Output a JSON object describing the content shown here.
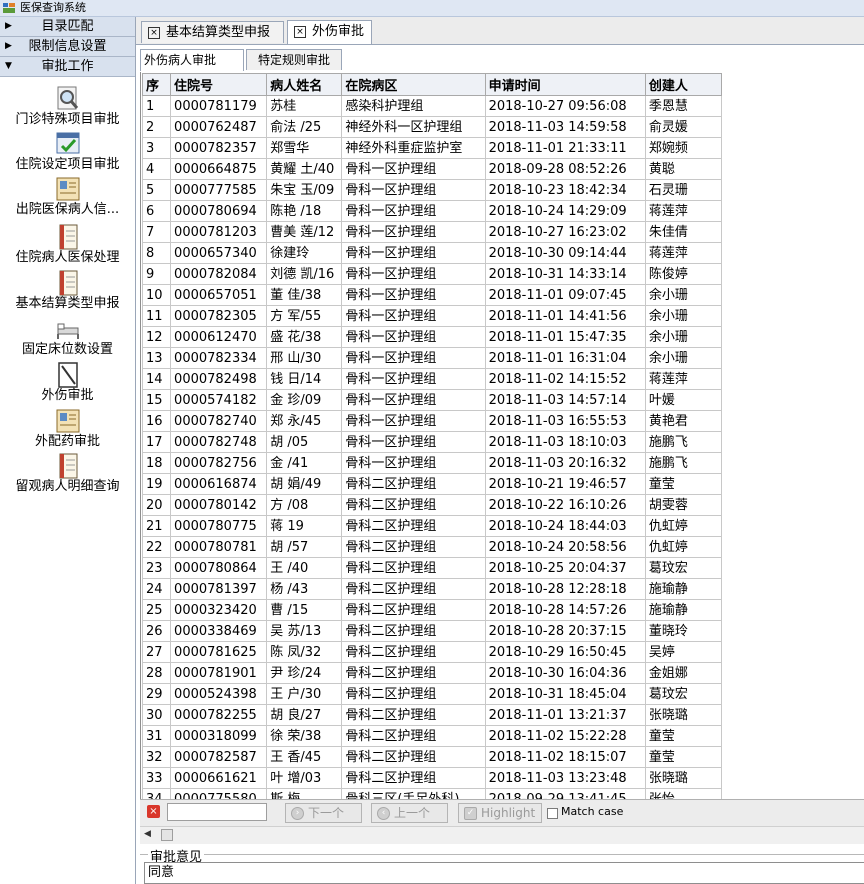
{
  "window": {
    "title": "医保查询系统"
  },
  "sidebar": {
    "headers": [
      {
        "label": "目录匹配",
        "arrow": "▶"
      },
      {
        "label": "限制信息设置",
        "arrow": "▶"
      },
      {
        "label": "审批工作",
        "arrow": "▼"
      }
    ],
    "items": [
      {
        "label": "门诊特殊项目审批",
        "icon": "magnifier-icon"
      },
      {
        "label": "住院设定项目审批",
        "icon": "checklist-icon"
      },
      {
        "label": "出院医保病人信...",
        "icon": "patient-card-icon"
      },
      {
        "label": "住院病人医保处理",
        "icon": "notebook-icon"
      },
      {
        "label": "基本结算类型申报",
        "icon": "notebook-icon"
      },
      {
        "label": "固定床位数设置",
        "icon": "bed-icon"
      },
      {
        "label": "外伤审批",
        "icon": "document-icon"
      },
      {
        "label": "外配药审批",
        "icon": "patient-card-icon"
      },
      {
        "label": "留观病人明细查询",
        "icon": "notebook-icon"
      }
    ]
  },
  "tabs": [
    {
      "label": "基本结算类型申报",
      "close": "×"
    },
    {
      "label": "外伤审批",
      "close": "×"
    }
  ],
  "subtabs": [
    {
      "label": "外伤病人审批"
    },
    {
      "label": "特定规则审批"
    }
  ],
  "grid": {
    "columns": [
      "序",
      "住院号",
      "病人姓名",
      "在院病区",
      "申请时间",
      "创建人"
    ],
    "rows": [
      [
        "1",
        "0000781179",
        "苏桂 ",
        "感染科护理组",
        "2018-10-27 09:56:08",
        "季恩慧"
      ],
      [
        "2",
        "0000762487",
        "俞法 /25",
        "神经外科一区护理组",
        "2018-11-03 14:59:58",
        "俞灵媛"
      ],
      [
        "3",
        "0000782357",
        "郑雪华",
        "神经外科重症监护室",
        "2018-11-01 21:33:11",
        "郑婉频"
      ],
      [
        "4",
        "0000664875",
        "黄耀 土/40",
        "骨科一区护理组",
        "2018-09-28 08:52:26",
        "黄聪"
      ],
      [
        "5",
        "0000777585",
        "朱宝 玉/09",
        "骨科一区护理组",
        "2018-10-23 18:42:34",
        "石灵珊"
      ],
      [
        "6",
        "0000780694",
        "陈艳 /18",
        "骨科一区护理组",
        "2018-10-24 14:29:09",
        "蒋莲萍"
      ],
      [
        "7",
        "0000781203",
        "曹美 莲/12",
        "骨科一区护理组",
        "2018-10-27 16:23:02",
        "朱佳倩"
      ],
      [
        "8",
        "0000657340",
        "徐建玲",
        "骨科一区护理组",
        "2018-10-30 09:14:44",
        "蒋莲萍"
      ],
      [
        "9",
        "0000782084",
        "刘德 凯/16",
        "骨科一区护理组",
        "2018-10-31 14:33:14",
        "陈俊婷"
      ],
      [
        "10",
        "0000657051",
        "董 佳/38",
        "骨科一区护理组",
        "2018-11-01 09:07:45",
        "余小珊"
      ],
      [
        "11",
        "0000782305",
        "方 军/55",
        "骨科一区护理组",
        "2018-11-01 14:41:56",
        "余小珊"
      ],
      [
        "12",
        "0000612470",
        "盛 花/38",
        "骨科一区护理组",
        "2018-11-01 15:47:35",
        "余小珊"
      ],
      [
        "13",
        "0000782334",
        "邢 山/30",
        "骨科一区护理组",
        "2018-11-01 16:31:04",
        "余小珊"
      ],
      [
        "14",
        "0000782498",
        "钱 日/14",
        "骨科一区护理组",
        "2018-11-02 14:15:52",
        "蒋莲萍"
      ],
      [
        "15",
        "0000574182",
        "金 珍/09",
        "骨科一区护理组",
        "2018-11-03 14:57:14",
        "叶媛"
      ],
      [
        "16",
        "0000782740",
        "郑 永/45",
        "骨科一区护理组",
        "2018-11-03 16:55:53",
        "黄艳君"
      ],
      [
        "17",
        "0000782748",
        "胡 /05",
        "骨科一区护理组",
        "2018-11-03 18:10:03",
        "施鹏飞"
      ],
      [
        "18",
        "0000782756",
        "金 /41",
        "骨科一区护理组",
        "2018-11-03 20:16:32",
        "施鹏飞"
      ],
      [
        "19",
        "0000616874",
        "胡 娟/49",
        "骨科二区护理组",
        "2018-10-21 19:46:57",
        "童莹"
      ],
      [
        "20",
        "0000780142",
        "方 /08",
        "骨科二区护理组",
        "2018-10-22 16:10:26",
        "胡雯蓉"
      ],
      [
        "21",
        "0000780775",
        "蒋 19",
        "骨科二区护理组",
        "2018-10-24 18:44:03",
        "仇虹婷"
      ],
      [
        "22",
        "0000780781",
        "胡 /57",
        "骨科二区护理组",
        "2018-10-24 20:58:56",
        "仇虹婷"
      ],
      [
        "23",
        "0000780864",
        "王 /40",
        "骨科二区护理组",
        "2018-10-25 20:04:37",
        "葛玟宏"
      ],
      [
        "24",
        "0000781397",
        "杨 /43",
        "骨科二区护理组",
        "2018-10-28 12:28:18",
        "施瑜静"
      ],
      [
        "25",
        "0000323420",
        "曹 /15",
        "骨科二区护理组",
        "2018-10-28 14:57:26",
        "施瑜静"
      ],
      [
        "26",
        "0000338469",
        "吴 苏/13",
        "骨科二区护理组",
        "2018-10-28 20:37:15",
        "董晓玲"
      ],
      [
        "27",
        "0000781625",
        "陈 凤/32",
        "骨科二区护理组",
        "2018-10-29 16:50:45",
        "吴婷"
      ],
      [
        "28",
        "0000781901",
        "尹 珍/24",
        "骨科二区护理组",
        "2018-10-30 16:04:36",
        "金姐娜"
      ],
      [
        "29",
        "0000524398",
        "王 户/30",
        "骨科二区护理组",
        "2018-10-31 18:45:04",
        "葛玟宏"
      ],
      [
        "30",
        "0000782255",
        "胡 良/27",
        "骨科二区护理组",
        "2018-11-01 13:21:37",
        "张晓璐"
      ],
      [
        "31",
        "0000318099",
        "徐 荣/38",
        "骨科二区护理组",
        "2018-11-02 15:22:28",
        "童莹"
      ],
      [
        "32",
        "0000782587",
        "王 香/45",
        "骨科二区护理组",
        "2018-11-02 18:15:07",
        "童莹"
      ],
      [
        "33",
        "0000661621",
        "叶 增/03",
        "骨科二区护理组",
        "2018-11-03 13:23:48",
        "张晓璐"
      ],
      [
        "34",
        "0000775580",
        "斯 梅",
        "骨科三区(手足外科)",
        "2018-09-29 13:41:45",
        "张怡"
      ]
    ]
  },
  "searchbar": {
    "input_value": "",
    "next_label": "下一个",
    "prev_label": "上一个",
    "highlight_label": "Highlight",
    "match_case_label": "Match case",
    "close_glyph": "×"
  },
  "opinion": {
    "legend": "审批意见",
    "value": "同意"
  },
  "colors": {
    "accent": "#d8e1ee",
    "close_red": "#d9372b"
  }
}
